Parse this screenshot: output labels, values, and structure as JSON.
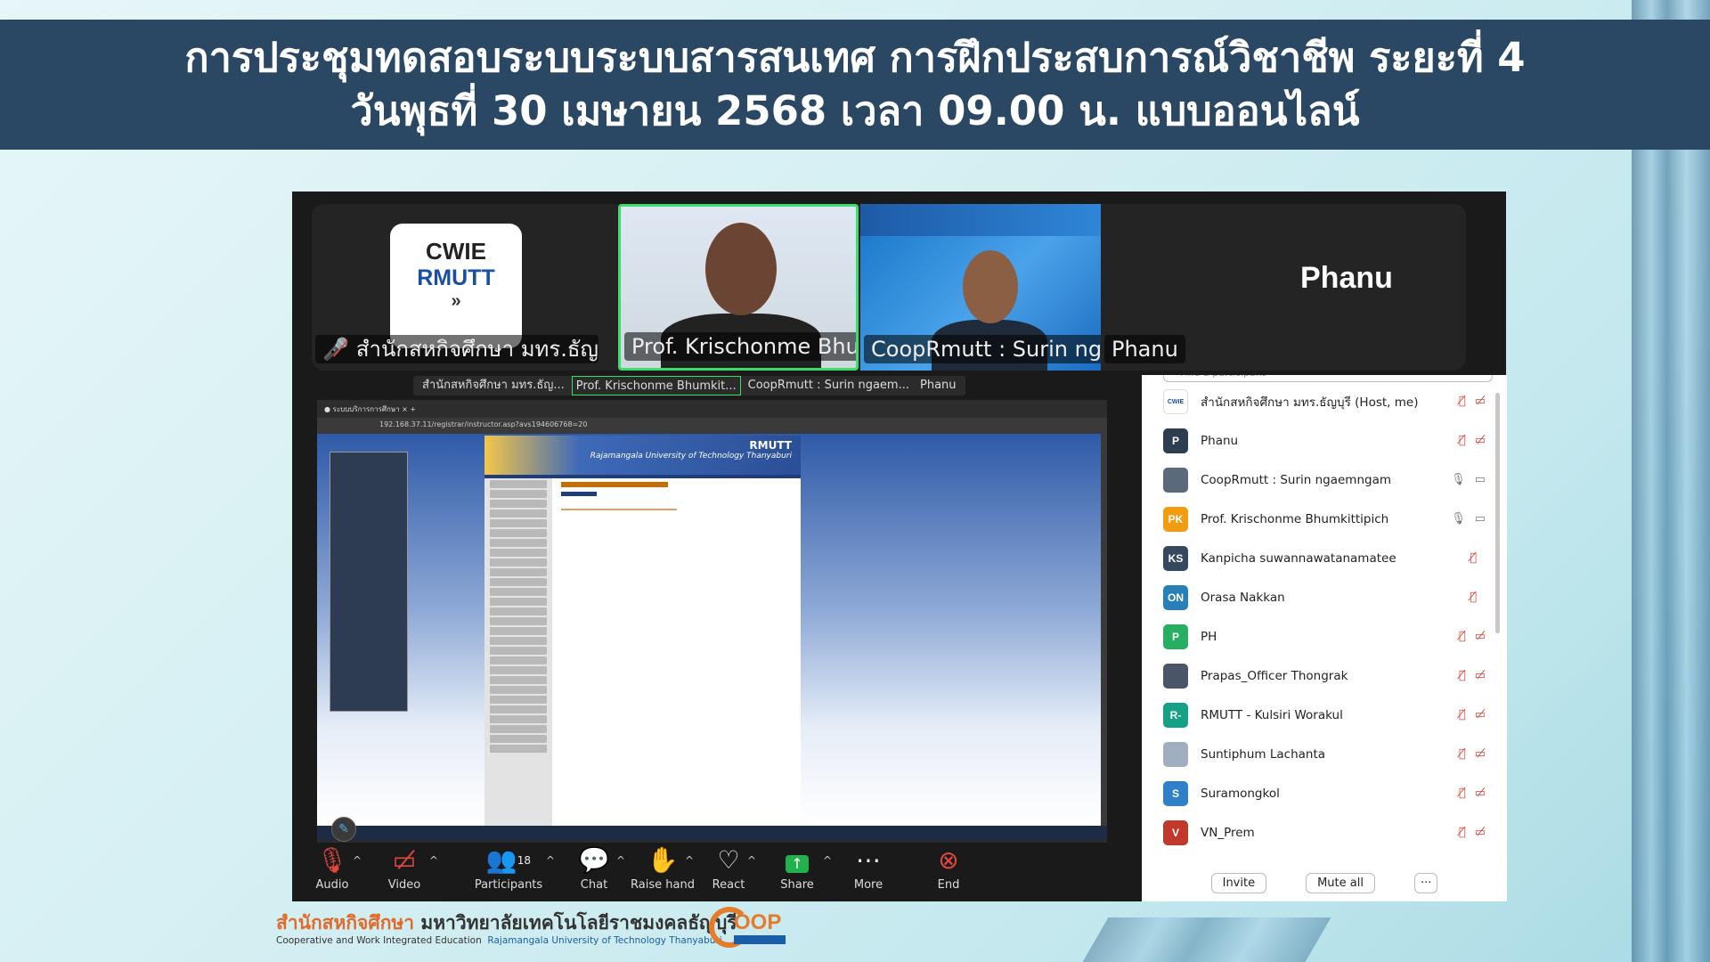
{
  "banner": {
    "line1": "การประชุมทดสอบระบบระบบสารสนเทศ การฝึกประสบการณ์วิชาชีพ ระยะที่ 4",
    "line2": "วันพุธที่ 30 เมษายน 2568 เวลา 09.00 น.  แบบออนไลน์"
  },
  "gallery": {
    "tiles": [
      {
        "name": "สำนักสหกิจศึกษา มทร.ธัญ...",
        "muted": true,
        "logo": {
          "line1": "CWIE",
          "line2": "RMUTT",
          "line3": "»"
        }
      },
      {
        "name": "Prof. Krischonme Bhumkit...",
        "active_speaker": true
      },
      {
        "name": "CoopRmutt : Surin ngaem..."
      },
      {
        "name": "Phanu",
        "center_label": "Phanu"
      }
    ]
  },
  "share_tabs": [
    "สำนักสหกิจศึกษา มทร.ธัญ...",
    "Prof. Krischonme Bhumkit...",
    "CoopRmutt : Surin ngaem...",
    "Phanu"
  ],
  "shared_screen": {
    "url": "192.168.37.11/registrar/instructor.asp?avs194606768=20",
    "site_title": "RMUTT",
    "site_subtitle": "Rajamangala University of Technology Thanyaburi"
  },
  "toolbar": {
    "audio": "Audio",
    "video": "Video",
    "participants": "Participants",
    "participants_count": "18",
    "chat": "Chat",
    "raise_hand": "Raise hand",
    "react": "React",
    "share": "Share",
    "more": "More",
    "end": "End"
  },
  "participants_panel": {
    "search_placeholder": "Find a participant",
    "items": [
      {
        "initials": "CWIE",
        "name": "สำนักสหกิจศึกษา มทร.ธัญบุรี (Host, me)",
        "color": "#ffffff"
      },
      {
        "initials": "P",
        "name": "Phanu",
        "color": "#2c3e50"
      },
      {
        "initials": "",
        "name": "CoopRmutt : Surin ngaemngam",
        "color": "#5a6a7a"
      },
      {
        "initials": "PK",
        "name": "Prof. Krischonme Bhumkittipich",
        "color": "#f39c12"
      },
      {
        "initials": "KS",
        "name": "Kanpicha suwannawatanamatee",
        "color": "#34495e"
      },
      {
        "initials": "ON",
        "name": "Orasa Nakkan",
        "color": "#2980b9"
      },
      {
        "initials": "P",
        "name": "PH",
        "color": "#27ae60"
      },
      {
        "initials": "",
        "name": "Prapas_Officer Thongrak",
        "color": "#4a5568"
      },
      {
        "initials": "R-",
        "name": "RMUTT - Kulsiri Worakul",
        "color": "#16a085"
      },
      {
        "initials": "",
        "name": "Suntiphum Lachanta",
        "color": "#a0aec0"
      },
      {
        "initials": "S",
        "name": "Suramongkol",
        "color": "#2f80c9"
      },
      {
        "initials": "V",
        "name": "VN_Prem",
        "color": "#c0392b"
      }
    ],
    "invite": "Invite",
    "mute_all": "Mute all",
    "more": "···"
  },
  "footer": {
    "thai_org_orange": "สำนักสหกิจศึกษา",
    "thai_org_dark": " มหาวิทยาลัยเทคโนโลยีราชมงคลธัญบุรี",
    "en_left": "Cooperative and Work Integrated Education",
    "en_right": "Rajamangala University of Technology Thanyaburi",
    "logo": "OOP"
  }
}
